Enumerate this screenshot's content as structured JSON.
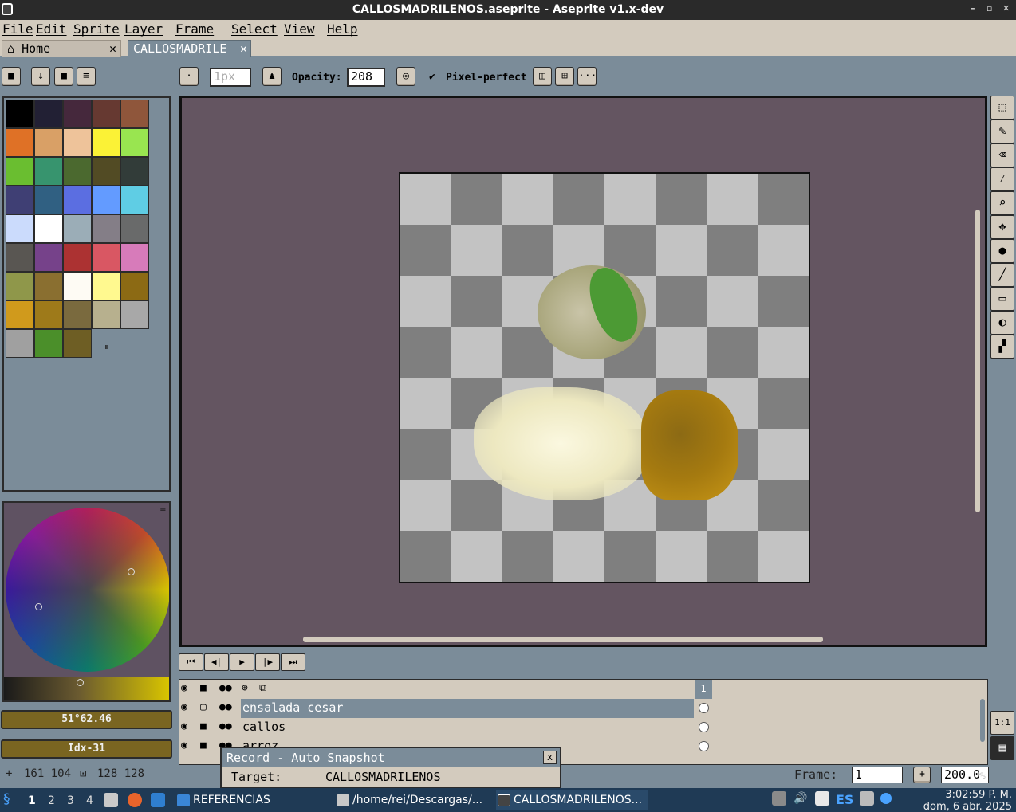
{
  "window": {
    "title": "CALLOSMADRILENOS.aseprite - Aseprite v1.x-dev",
    "controls": [
      "–",
      "▫",
      "✕"
    ]
  },
  "menu": [
    "File",
    "Edit",
    "Sprite",
    "Layer",
    "Frame",
    "Select",
    "View",
    "Help"
  ],
  "tabs": {
    "home": "Home",
    "active": "CALLOSMADRILE",
    "close": "✕"
  },
  "toolbar": {
    "brush_size_placeholder": "1px",
    "opacity_label": "Opacity:",
    "opacity_value": "208",
    "pixel_perfect_label": "Pixel-perfect",
    "check": "✔",
    "more": "···"
  },
  "palette": {
    "colors": [
      "#000000",
      "#222034",
      "#45283c",
      "#663931",
      "#8f563b",
      "#df7126",
      "#d9a066",
      "#eec39a",
      "#fbf236",
      "#99e550",
      "#6abe30",
      "#37946e",
      "#4b692f",
      "#524b24",
      "#323c39",
      "#3f3f74",
      "#306082",
      "#5b6ee1",
      "#639bff",
      "#5fcde4",
      "#cbdbfc",
      "#ffffff",
      "#9badb7",
      "#847e87",
      "#696a6a",
      "#595652",
      "#76428a",
      "#ac3232",
      "#d95763",
      "#d77bba",
      "#8f974a",
      "#8a6f30",
      "#fefbf4",
      "#fff98f",
      "#8c6a14",
      "#d09a1c",
      "#9e7a1a",
      "#7a6a3e",
      "#b7b08e",
      "#a8a8a8",
      "#a0a0a0",
      "#4b8f2a",
      "#6e5e24"
    ],
    "handle": "⏸"
  },
  "color_info": {
    "hsv": "51°62.46",
    "index": "Idx-31"
  },
  "timeline": {
    "buttons": [
      "⏮",
      "◀|",
      "▶",
      "|▶",
      "⏭"
    ],
    "frame_header": "1",
    "layers": [
      {
        "name": "ensalada cesar",
        "selected": true
      },
      {
        "name": "callos",
        "selected": false
      },
      {
        "name": "arroz",
        "selected": false
      }
    ]
  },
  "popup": {
    "title": "Record - Auto Snapshot",
    "target_label": "Target:",
    "target_value": "CALLOSMADRILENOS",
    "close": "x"
  },
  "status": {
    "pos": "161 104",
    "size": "128 128",
    "frame_label": "Frame:",
    "frame_value": "1",
    "zoom_value": "200.0",
    "zoom_suffix": "%",
    "plus": "+",
    "pos_icon": "+",
    "size_icon": "⊡"
  },
  "tools": {
    "one_to_one": "1:1",
    "layers_icon": "▤"
  },
  "taskbar": {
    "workspaces": [
      "1",
      "2",
      "3",
      "4"
    ],
    "apps": [
      {
        "label": "REFERENCIAS",
        "color": "#3a86d6"
      },
      {
        "label": "/home/rei/Descargas/...",
        "color": "#c8c8c8"
      },
      {
        "label": "CALLOSMADRILENOS...",
        "color": "#444444"
      }
    ],
    "lang": "ES",
    "time": "3:02:59 P. M.",
    "date": "dom, 6 abr. 2025"
  }
}
